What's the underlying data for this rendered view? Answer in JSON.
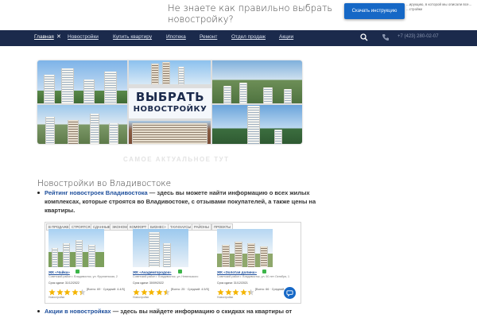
{
  "promo": {
    "text": "Не знаете как правильно выбрать новостройку?",
    "button_label": "Скачать инструкцию",
    "note": "...ирукцию, в которой мы описали все... ...стройки"
  },
  "nav": {
    "items": [
      {
        "label": "Главная"
      },
      {
        "label": "Новостройки"
      },
      {
        "label": "Купить квартиру"
      },
      {
        "label": "Ипотека"
      },
      {
        "label": "Ремонт"
      },
      {
        "label": "Отдел продаж"
      },
      {
        "label": "Акции"
      }
    ],
    "close_glyph": "✕",
    "phone": "+7 (423) 280-02-07"
  },
  "banner": {
    "line1": "ВЫБРАТЬ",
    "line2": "НОВОСТРОЙКУ"
  },
  "tagline": "САМОЕ АКТУАЛЬНОЕ ТУТ",
  "heading": "Новостройки во Владивостоке",
  "bullets": [
    {
      "link": "Рейтинг новостроек Владивостока",
      "text": " — здесь вы можете найти информацию о всех жилых комплексах, которые строятся во Владивостоке, с отзывами покупателей, а также цены на квартиры."
    },
    {
      "link": "Акции в новостройках",
      "text": " — здесь вы найдете информацию о скидках на квартиры от"
    }
  ],
  "widget": {
    "tabs": [
      "В ПРОДАЖЕ",
      "СТРОЯТСЯ",
      "СДАННЫЕ",
      "ЭКОНОМ",
      "КОМФОРТ",
      "БИЗНЕС+",
      "ТАУНХАУСЫ",
      "РАЙОНЫ",
      "ПРОЕКТЫ"
    ],
    "cards": [
      {
        "name": "ЖК «Чайка»",
        "address": "Советский район г. Владивосток, ул. Фрунзенская, 2",
        "deadline": "Срок сдачи: 31/12/2022",
        "stat": "[Всего: 69 · Средний: 4.4/5]",
        "foot": "Новостройки",
        "rating": 4.4
      },
      {
        "name": "ЖК «Академгородок»",
        "address": "Советский район г. Владивосток, ул. Невельского",
        "deadline": "Срок сдачи: 30/09/2022",
        "stat": "[Всего: 25 · Средний: 4.5/5]",
        "foot": "Новостройки",
        "rating": 4.5
      },
      {
        "name": "ЖК «Золотая долина»",
        "address": "Советский район г. Владивосток, ул. 50 лет Октября, 1",
        "deadline": "Срок сдачи: 31/12/2021",
        "stat": "[Всего: 66 · Средний: 4.4/5]",
        "foot": "Новостройки",
        "rating": 4.4
      }
    ]
  },
  "colors": {
    "nav_bg": "#1b2a4c",
    "accent": "#1668c6",
    "link": "#1e4f9c",
    "star": "#f4b400"
  }
}
